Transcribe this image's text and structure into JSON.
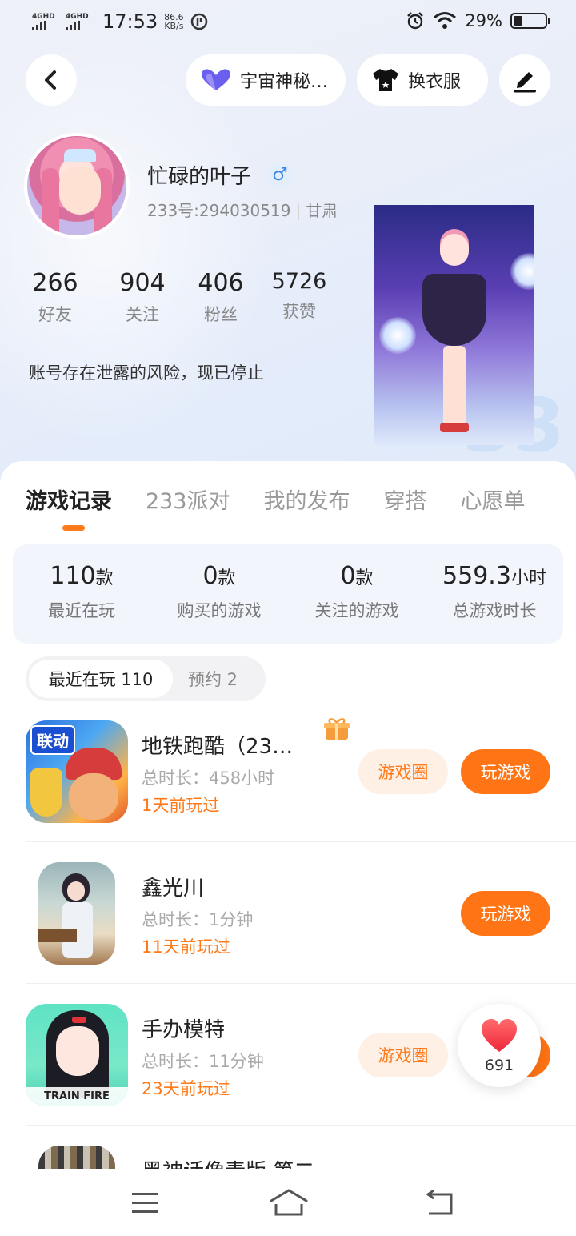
{
  "status_bar": {
    "net1": "4GHD",
    "net2": "4GHD",
    "time": "17:53",
    "speed_value": "86.6",
    "speed_unit": "KB/s",
    "battery_pct": "29%",
    "battery_level": 0.29
  },
  "header": {
    "back_icon": "chevron-left-icon",
    "title_badge": "宇宙神秘…",
    "outfit_label": "换衣服",
    "edit_icon": "pencil-icon"
  },
  "profile": {
    "name": "忙碌的叶子",
    "gender_symbol": "♂",
    "uid": "233号:294030519",
    "region": "甘肃",
    "bio": "账号存在泄露的风险，现已停止",
    "stats": [
      {
        "value": "266",
        "label": "好友"
      },
      {
        "value": "904",
        "label": "关注"
      },
      {
        "value": "406",
        "label": "粉丝"
      },
      {
        "value": "5726",
        "label": "获赞"
      }
    ]
  },
  "tabs": [
    "游戏记录",
    "233派对",
    "我的发布",
    "穿搭",
    "心愿单"
  ],
  "summary": [
    {
      "value": "110",
      "unit": "款",
      "label": "最近在玩"
    },
    {
      "value": "0",
      "unit": "款",
      "label": "购买的游戏"
    },
    {
      "value": "0",
      "unit": "款",
      "label": "关注的游戏"
    },
    {
      "value": "559.3",
      "unit": "小时",
      "label": "总游戏时长"
    }
  ],
  "segment": {
    "recent": "最近在玩 110",
    "reserve": "预约 2"
  },
  "games": [
    {
      "name": "地铁跑酷（23…",
      "time": "总时长：458小时",
      "last": "1天前玩过",
      "circle": "游戏圈",
      "play": "玩游戏",
      "icon_text": "联动"
    },
    {
      "name": "鑫光川",
      "time": "总时长：1分钟",
      "last": "11天前玩过",
      "play": "玩游戏"
    },
    {
      "name": "手办模特",
      "time": "总时长：11分钟",
      "last": "23天前玩过",
      "circle": "游戏圈",
      "icon_text": "TRAIN FIRE"
    },
    {
      "name": "黑神话像素版 第二…"
    }
  ],
  "like": {
    "count": "691"
  },
  "colors": {
    "accent": "#ff7414",
    "accent_soft": "#fff0e5",
    "gender_blue": "#3a86e6"
  }
}
